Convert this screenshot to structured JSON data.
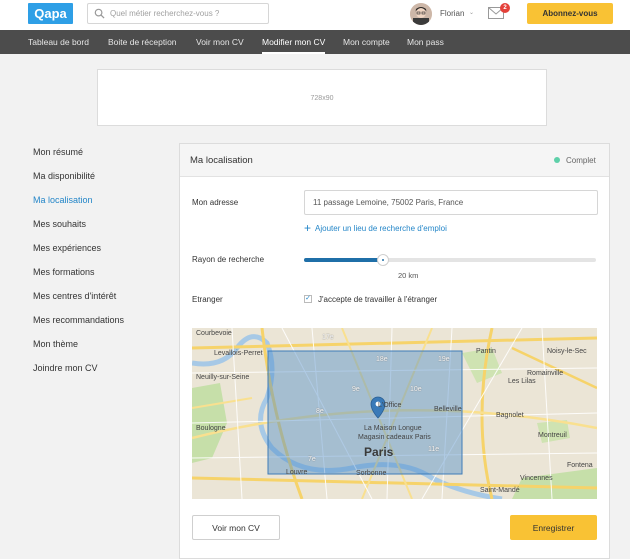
{
  "header": {
    "logo": "Qapa",
    "search_placeholder": "Quel métier recherchez-vous ?",
    "user_name": "Florian",
    "user_caret": "⌄",
    "notification_count": "2",
    "subscribe_label": "Abonnez-vous"
  },
  "nav": {
    "items": [
      {
        "label": "Tableau de bord"
      },
      {
        "label": "Boite de réception"
      },
      {
        "label": "Voir mon CV"
      },
      {
        "label": "Modifier mon CV"
      },
      {
        "label": "Mon compte"
      },
      {
        "label": "Mon pass"
      }
    ],
    "active_index": 3
  },
  "ad": {
    "label": "728x90"
  },
  "sidebar": {
    "items": [
      {
        "label": "Mon résumé"
      },
      {
        "label": "Ma disponibilité"
      },
      {
        "label": "Ma localisation"
      },
      {
        "label": "Mes souhaits"
      },
      {
        "label": "Mes expériences"
      },
      {
        "label": "Mes formations"
      },
      {
        "label": "Mes centres d'intérêt"
      },
      {
        "label": "Mes recommandations"
      },
      {
        "label": "Mon thème"
      },
      {
        "label": "Joindre mon CV"
      }
    ],
    "active_index": 2
  },
  "panel": {
    "title": "Ma localisation",
    "status": "Complet",
    "status_color": "#5ed0a9",
    "address_label": "Mon adresse",
    "address_value": "11 passage Lemoine, 75002 Paris, France",
    "add_location_label": "Ajouter un lieu de recherche d'emploi",
    "radius_label": "Rayon de recherche",
    "radius_fraction": 0.27,
    "radius_value": "20 km",
    "abroad_label": "Etranger",
    "abroad_checked": true,
    "abroad_text": "J'accepte de travailler à l'étranger",
    "view_cv_label": "Voir mon CV",
    "save_label": "Enregistrer"
  },
  "map": {
    "places": {
      "courbevoie": "Courbevoie",
      "levallois": "Levallois-Perret",
      "neuilly": "Neuilly-sur-Seine",
      "pantin": "Pantin",
      "noisy": "Noisy-le-Sec",
      "lilas": "Les Lilas",
      "romainville": "Romainville",
      "bagnolet": "Bagnolet",
      "montreuil": "Montreuil",
      "fontenay": "Fontena",
      "saint_mande": "Saint-Mandé",
      "vincennes": "Vincennes",
      "boulogne": "Boulogne",
      "paris": "Paris",
      "arr_18": "18e",
      "arr_19": "19e",
      "arr_17": "17e",
      "arr_9": "9e",
      "arr_8": "8e",
      "arr_10": "10e",
      "arr_7": "7e",
      "arr_11": "11e",
      "arr_2": "2e",
      "arr_16": "16e",
      "arr_20": "20e",
      "louvre": "Louvre",
      "officel": "L'Office",
      "maison": "La Maison Longue",
      "magasin": "Magasin cadeaux Paris",
      "sorbonne": "Sorbonne",
      "belleville": "Belleville"
    },
    "radius_color": "#4f8ec9",
    "pin_color": "#3a7ab8"
  }
}
